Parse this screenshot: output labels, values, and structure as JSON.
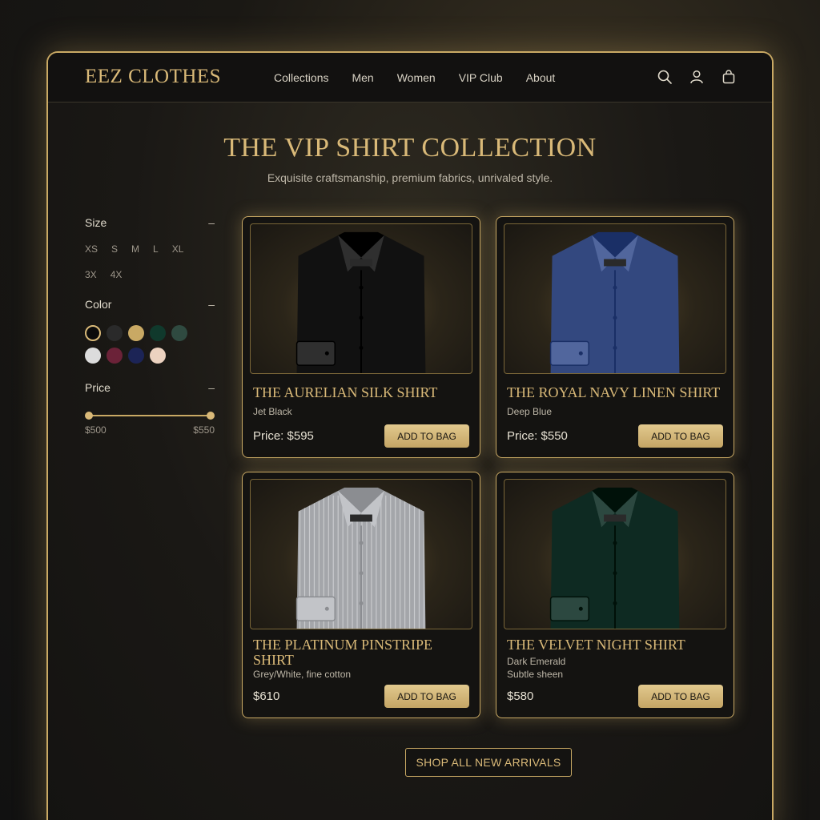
{
  "header": {
    "logo": "EEZ CLOTHES",
    "nav": [
      "Collections",
      "Men",
      "Women",
      "VIP Club",
      "About"
    ],
    "icons": [
      "search-icon",
      "account-icon",
      "shopping-bag-icon"
    ]
  },
  "hero": {
    "title": "THE VIP SHIRT COLLECTION",
    "subtitle": "Exquisite craftsmanship, premium fabrics, unrivaled style."
  },
  "filters": {
    "size": {
      "label": "Size",
      "options": [
        "XS",
        "S",
        "M",
        "L",
        "XL",
        "3X",
        "4X"
      ]
    },
    "color": {
      "label": "Color",
      "swatches": [
        "#0b0b0b",
        "#2a2a2a",
        "#c9a964",
        "#10392c",
        "#2f4a40",
        "#dcdcdc",
        "#6b2238",
        "#1c2456",
        "#ecd2c0"
      ],
      "selected_index": 0
    },
    "price": {
      "label": "Price",
      "min": "$500",
      "max": "$550"
    },
    "collapse_icon": "minus-icon"
  },
  "products": [
    {
      "title": "THE AURELIAN SILK SHIRT",
      "subtitle": "Jet Black",
      "subtitle2": "",
      "price": "Price: $595",
      "button": "ADD TO BAG",
      "color": "#111111",
      "pattern": "plain"
    },
    {
      "title": "THE ROYAL NAVY LINEN SHIRT",
      "subtitle": "Deep Blue",
      "subtitle2": "",
      "price": "Price: $550",
      "button": "ADD TO BAG",
      "color": "#33487f",
      "pattern": "plain"
    },
    {
      "title": "THE PLATINUM PINSTRIPE SHIRT",
      "subtitle": "Grey/White, fine cotton",
      "subtitle2": "",
      "price": "$610",
      "button": "ADD TO BAG",
      "color": "#a4a6aa",
      "pattern": "stripe"
    },
    {
      "title": "THE VELVET NIGHT SHIRT",
      "subtitle": "Dark Emerald",
      "subtitle2": "Subtle sheen",
      "price": "$580",
      "button": "ADD TO BAG",
      "color": "#0e2a22",
      "pattern": "plain"
    }
  ],
  "cta": {
    "label": "SHOP ALL NEW ARRIVALS"
  },
  "colors": {
    "gold": "#d9b978",
    "border_gold": "#c9a964",
    "background": "#141311"
  }
}
